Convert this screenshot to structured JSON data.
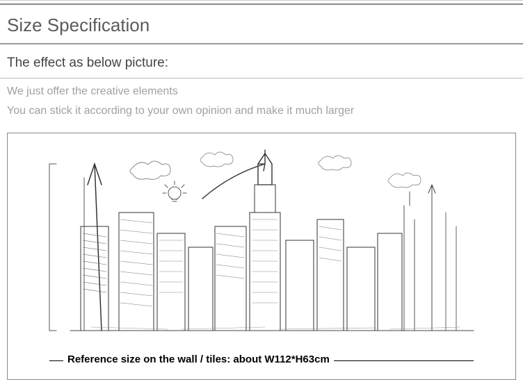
{
  "heading": "Size Specification",
  "sub_heading": "The effect as below picture:",
  "desc_line1": "We just offer the creative elements",
  "desc_line2": "You can stick it according to your own opinion and make it much larger",
  "reference_text": "Reference size on the wall / tiles: about W112*H63cm"
}
